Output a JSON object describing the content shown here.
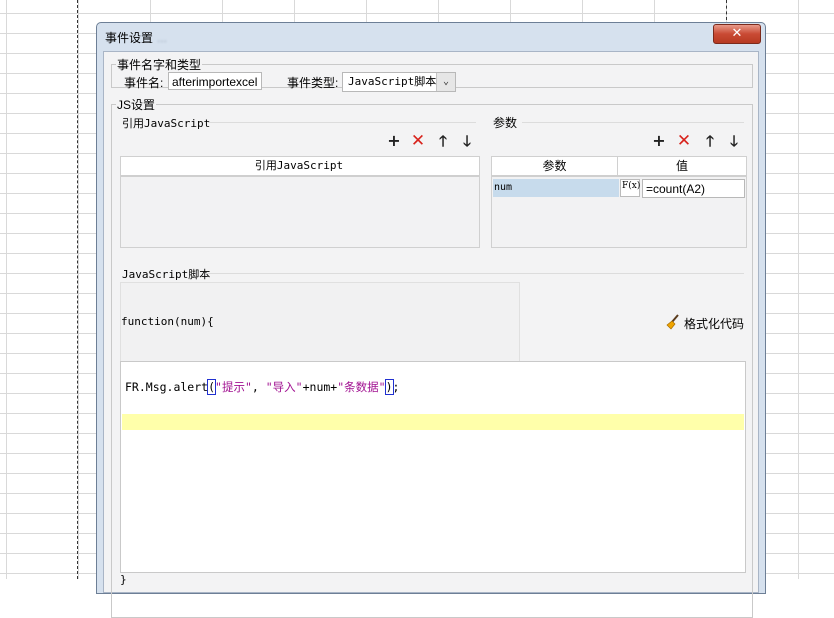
{
  "dialog": {
    "title": "事件设置",
    "title_suffix": "...",
    "close_glyph": "✕"
  },
  "event_section": {
    "legend": "事件名字和类型",
    "name_label": "事件名:",
    "name_value": "afterimportexcel",
    "type_label": "事件类型:",
    "type_value": "JavaScript脚本",
    "type_arrow": "⌄"
  },
  "js_section": {
    "legend": "JS设置",
    "ref_js": {
      "title": "引用JavaScript",
      "column_header": "引用JavaScript"
    },
    "params": {
      "title": "参数",
      "columns": [
        "参数",
        "值"
      ],
      "rows": [
        {
          "name": "num",
          "formula_icon": "F(x)",
          "value": "=count(A2)"
        }
      ]
    },
    "toolbar": {
      "add": "+",
      "delete": "✕",
      "up": "🡑",
      "down": "🡓"
    },
    "script": {
      "title": "JavaScript脚本",
      "header_line": "function(num){",
      "format_button": "格式化代码",
      "code": {
        "prefix": "FR.Msg.alert",
        "open": "(",
        "str1": "\"提示\"",
        "comma": ", ",
        "str2": "\"导入\"",
        "plus1": "+num+",
        "str3": "\"条数据\"",
        "close": ")",
        "end": ";"
      },
      "footer_line": "}"
    }
  },
  "colors": {
    "dialog_frame": "#d6e1ee",
    "close_button": "#c94a34",
    "delete_icon": "#d8231c",
    "string_literal": "#a11191",
    "current_line": "#ffffaa",
    "selected_cell": "#c7dbec"
  }
}
